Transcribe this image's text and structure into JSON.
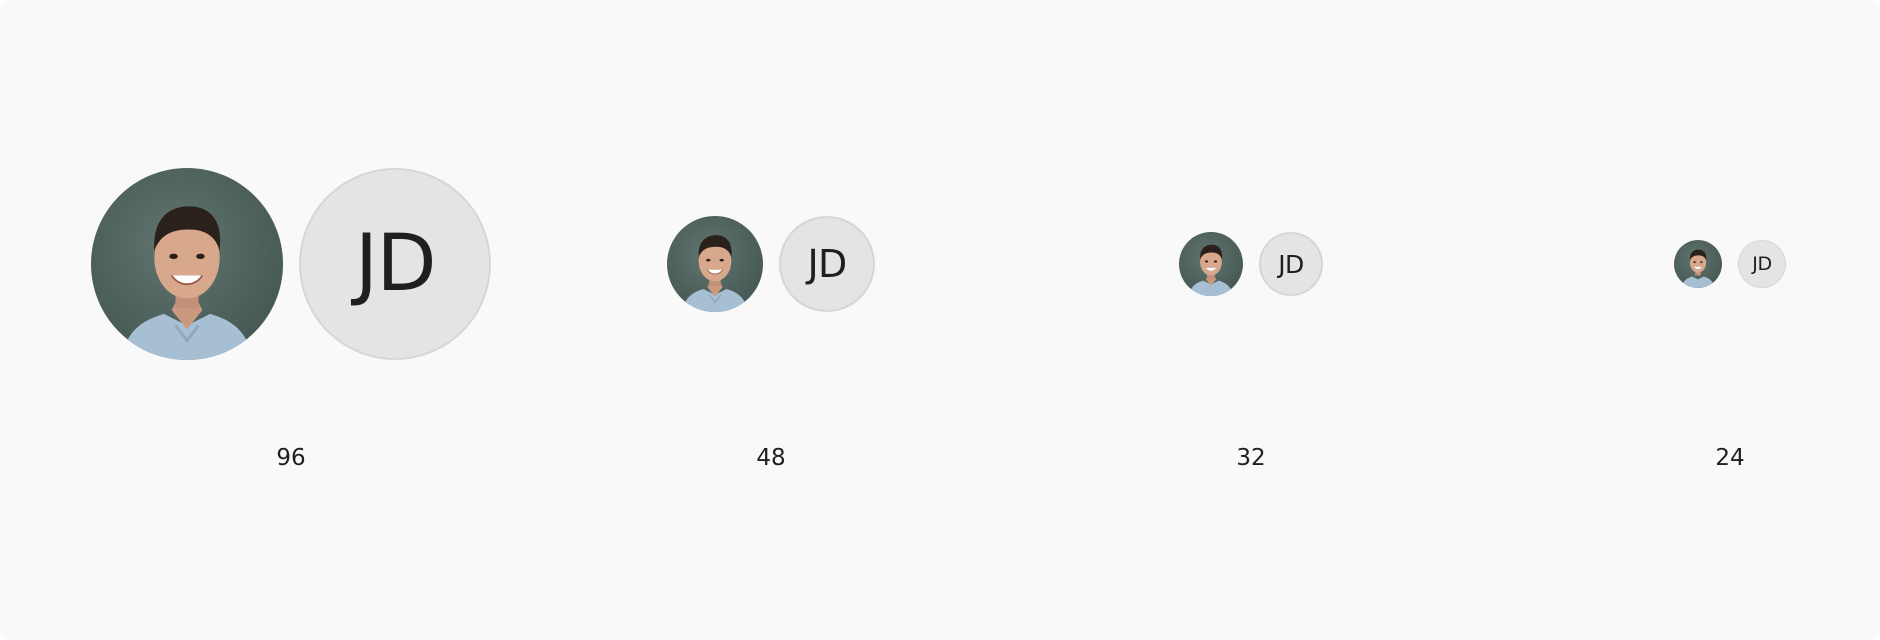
{
  "avatar_sizes": [
    {
      "size_label": "96",
      "initials": "JD"
    },
    {
      "size_label": "48",
      "initials": "JD"
    },
    {
      "size_label": "32",
      "initials": "JD"
    },
    {
      "size_label": "24",
      "initials": "JD"
    }
  ],
  "colors": {
    "background": "#f9f9f9",
    "initials_avatar_fill": "#e4e4e4",
    "initials_avatar_border": "#d6d6d6",
    "photo_backdrop": "#4d605c",
    "text": "#1f1f1f"
  },
  "icons": {
    "photo_avatar": "person-photo-icon"
  }
}
